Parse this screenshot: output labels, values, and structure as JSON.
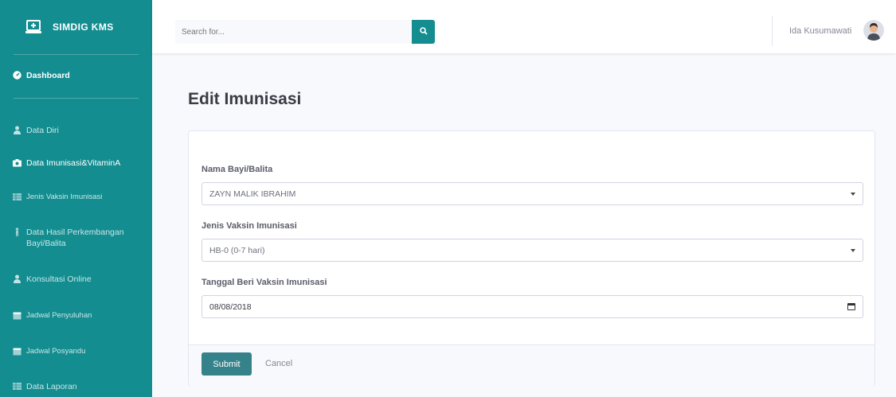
{
  "sidebar": {
    "brand": "SIMDIG KMS",
    "brand_icon": "laptop-medical-icon",
    "items": [
      {
        "label": "Dashboard",
        "icon": "tachometer-icon"
      },
      {
        "label": "Data Diri",
        "icon": "user-icon"
      },
      {
        "label": "Data Imunisasi&VitaminA",
        "icon": "camera-icon"
      },
      {
        "label": "Jenis Vaksin Imunisasi",
        "icon": "table-icon"
      },
      {
        "label": "Data Hasil Perkembangan Bayi/Balita",
        "icon": "child-icon"
      },
      {
        "label": "Konsultasi Online",
        "icon": "user-icon"
      },
      {
        "label": "Jadwal Penyuluhan",
        "icon": "calendar-icon"
      },
      {
        "label": "Jadwal Posyandu",
        "icon": "calendar-icon"
      },
      {
        "label": "Data Laporan",
        "icon": "table-icon"
      }
    ]
  },
  "topbar": {
    "search_placeholder": "Search for...",
    "search_icon": "search-icon",
    "user_name": "Ida Kusumawati"
  },
  "main": {
    "title": "Edit Imunisasi",
    "form": {
      "baby_label": "Nama Bayi/Balita",
      "baby_value": "ZAYN MALIK IBRAHIM",
      "vaccine_label": "Jenis Vaksin Imunisasi",
      "vaccine_value": "HB-0 (0-7 hari)",
      "date_label": "Tanggal Beri Vaksin Imunisasi",
      "date_value": "08/08/2018",
      "submit_label": "Submit",
      "cancel_label": "Cancel"
    }
  },
  "colors": {
    "sidebar": "#138d90",
    "accent": "#36828b",
    "background": "#f8f9fc"
  }
}
